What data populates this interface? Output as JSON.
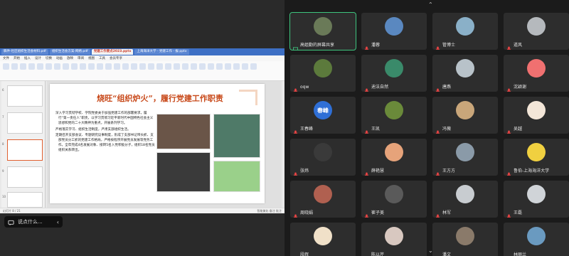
{
  "wps": {
    "tabs": [
      "稿件-社区组织生活会材料.pdf",
      "组织生活会方案-网络.pdf",
      "党建工作要点2023.pptx",
      "上海海洋大学 - 党建工作 - 报.pptx"
    ],
    "menu": [
      "文件",
      "开始",
      "插入",
      "设计",
      "切换",
      "动画",
      "放映",
      "审阅",
      "视图",
      "工具",
      "会员专享"
    ],
    "slide_title": "烧旺“组织炉火”，履行党建工作职责",
    "bullets": [
      "深入学习贯彻学校、学院党委关于加强党建工作的部署要求，履行“第一责任人”职责，以学习贯彻习近平新时代中国特色社会主义思想和党的二十大精神为重点，开展系列学习。",
      "严格落实学习、组织生活制度，严肃支部组织生活。",
      "定期召开支部会议、专题研究议事制度，形成了支部书记带头抓、支部党员分工抓的党建工作格局，严格按程序开展党员发展等党务工作。全年完成4名发展对象、接转5名入党积极分子，组织18名党员组织关系转出。"
    ],
    "thumb_nums": [
      "6",
      "7",
      "8",
      "9",
      "10"
    ],
    "status_left": "幻灯片 8 / 21",
    "status_right": "智能美化  备注  批注"
  },
  "speak": {
    "label": "说点什么..."
  },
  "participants": [
    {
      "name": "高姐勤的屏幕共享",
      "color": "#6a7a58",
      "active": true
    },
    {
      "name": "潘蓉",
      "color": "#5a88c0"
    },
    {
      "name": "管博士",
      "color": "#8ab0c8"
    },
    {
      "name": "道风",
      "color": "#b5b9bd"
    },
    {
      "name": "oqw",
      "color": "#5c7a3c"
    },
    {
      "name": "迪法自然",
      "color": "#3a8a6a"
    },
    {
      "name": "唐燕",
      "color": "#b8c2c9"
    },
    {
      "name": "沈颖谢",
      "color": "#f07070"
    },
    {
      "name": "王春峰",
      "color": "#2f6fd6",
      "initials": "春峰"
    },
    {
      "name": "王凯",
      "color": "#6a8a3a"
    },
    {
      "name": "冯薇",
      "color": "#c9a67a"
    },
    {
      "name": "吴越",
      "color": "#f3e6d8"
    },
    {
      "name": "张炜",
      "color": "#3a3a3a"
    },
    {
      "name": "薛艳慧",
      "color": "#e6a37a"
    },
    {
      "name": "王方方",
      "color": "#8a9aa8"
    },
    {
      "name": "鲁伯-上海海洋大学",
      "color": "#f0d040"
    },
    {
      "name": "周晓娟",
      "color": "#b06050"
    },
    {
      "name": "崔子美",
      "color": "#5a5a5a"
    },
    {
      "name": "林军",
      "color": "#c8ccd0"
    },
    {
      "name": "王磊",
      "color": "#d0d4d8"
    },
    {
      "name": "段辉",
      "color": "#f0e0c8"
    },
    {
      "name": "陈以芹",
      "color": "#d8c8c0"
    },
    {
      "name": "潘文",
      "color": "#8a7a6a"
    },
    {
      "name": "林丽兰",
      "color": "#6a9ac0"
    }
  ],
  "colors": {
    "active_border": "#3ec47e",
    "title": "#c8491a"
  }
}
